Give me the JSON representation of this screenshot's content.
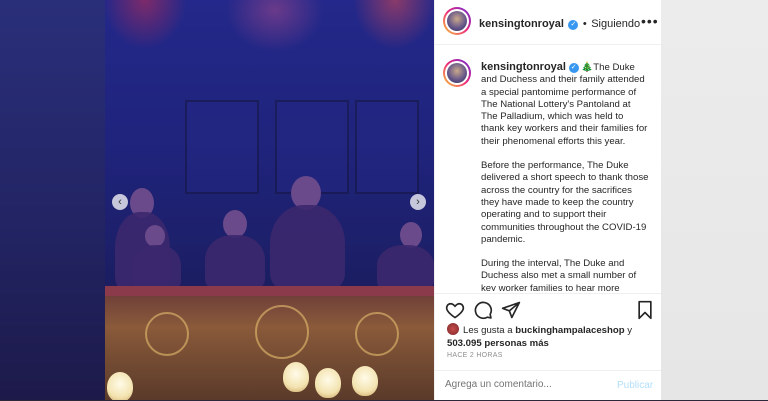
{
  "post": {
    "username": "kensingtonroyal",
    "verified_badge": "✓",
    "separator": "•",
    "follow_status": "Siguiendo",
    "more_icon": "•••",
    "caption_emoji": "🎄",
    "caption_paragraphs": [
      "The Duke and Duchess and their family attended a special pantomime performance of The National Lottery's Pantoland at The Palladium, which was held to thank key workers and their families for their phenomenal efforts this year.",
      "Before the performance, The Duke delivered a short speech to thank those across the country for the sacrifices they have made to keep the country operating and to support their communities throughout the COVID-19 pandemic.",
      "During the interval, The Duke and Duchess also met a small number of key worker families to hear more"
    ],
    "likes_prefix": "Les gusta a",
    "likes_user": "buckinghampalaceshop",
    "likes_joiner": "y",
    "likes_count": "503.095 personas más",
    "timestamp": "HACE 2 HORAS",
    "comment_placeholder": "Agrega un comentario...",
    "publish_label": "Publicar"
  },
  "carousel": {
    "prev_icon": "‹",
    "next_icon": "›"
  },
  "icons": {
    "heart": "heart-icon",
    "comment": "comment-icon",
    "share": "share-icon",
    "save": "bookmark-icon"
  },
  "colors": {
    "verified": "#3897f0",
    "publish_disabled": "#b2dffc",
    "muted": "#8e8e8e",
    "text": "#262626"
  }
}
